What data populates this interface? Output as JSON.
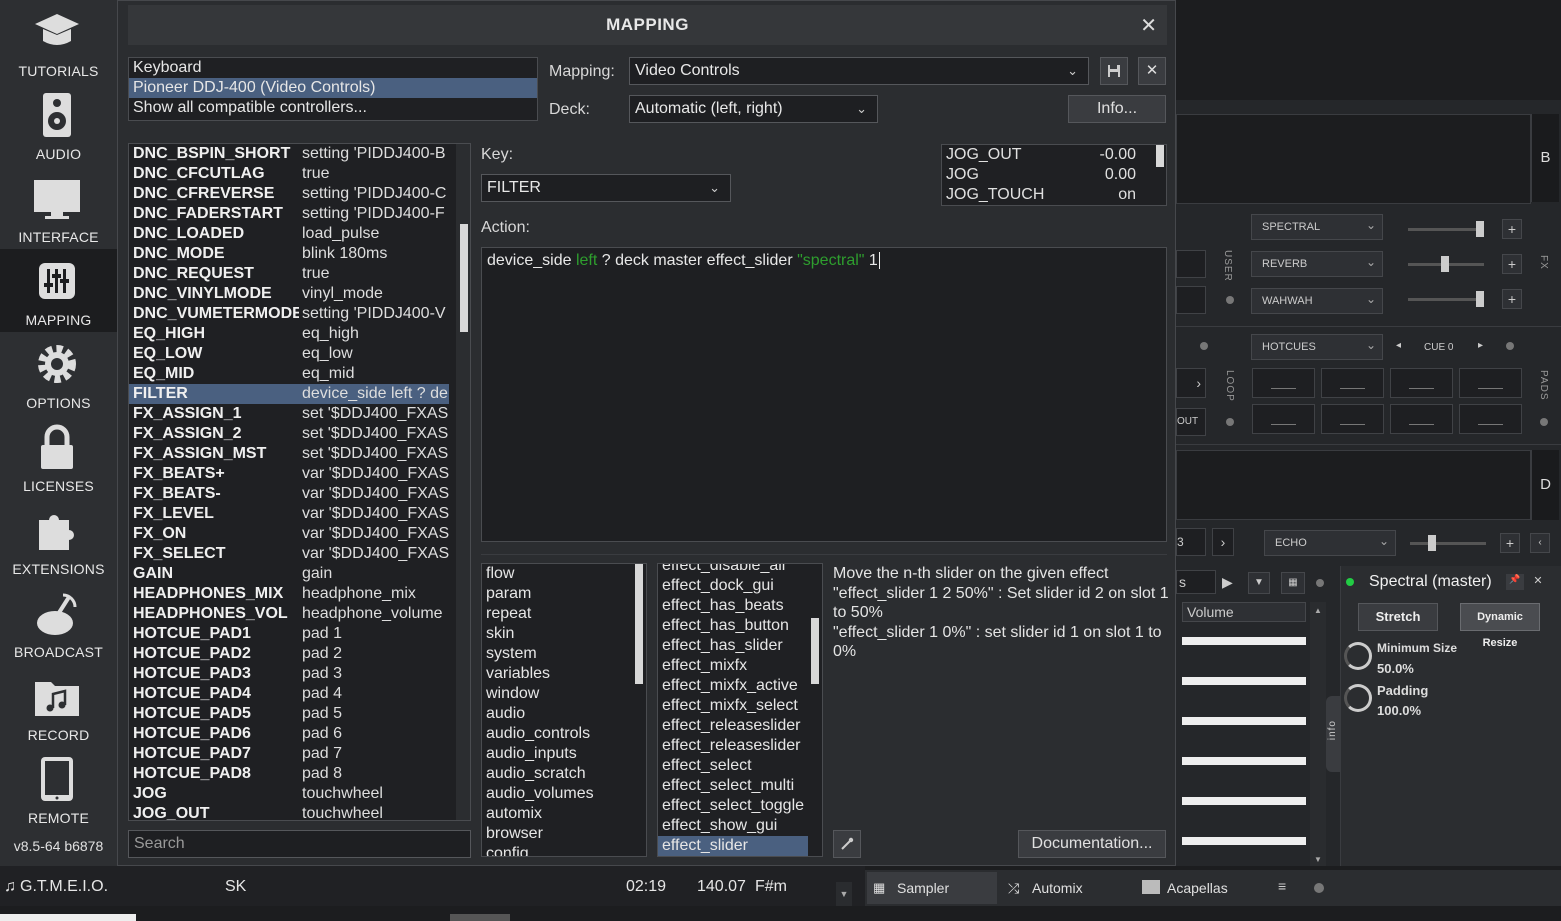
{
  "sidebar": {
    "items": [
      {
        "label": "TUTORIALS",
        "icon": "graduation-cap-icon"
      },
      {
        "label": "AUDIO",
        "icon": "speaker-icon"
      },
      {
        "label": "INTERFACE",
        "icon": "monitor-icon"
      },
      {
        "label": "MAPPING",
        "icon": "sliders-icon"
      },
      {
        "label": "OPTIONS",
        "icon": "gear-icon"
      },
      {
        "label": "LICENSES",
        "icon": "lock-icon"
      },
      {
        "label": "EXTENSIONS",
        "icon": "puzzle-icon"
      },
      {
        "label": "BROADCAST",
        "icon": "satellite-icon"
      },
      {
        "label": "RECORD",
        "icon": "music-folder-icon"
      },
      {
        "label": "REMOTE",
        "icon": "tablet-icon"
      }
    ],
    "version": "v8.5-64 b6878"
  },
  "dialog": {
    "title": "MAPPING",
    "controllers": [
      "Keyboard",
      "Pioneer DDJ-400 (Video Controls)",
      "Show all compatible controllers..."
    ],
    "mapping_label": "Mapping:",
    "mapping_value": "Video Controls",
    "deck_label": "Deck:",
    "deck_value": "Automatic (left, right)",
    "info_button": "Info...",
    "key_label": "Key:",
    "key_value": "FILTER",
    "action_label": "Action:",
    "action_tokens": [
      "device_side ",
      "left",
      " ? deck master effect_slider ",
      "\"spectral\"",
      " 1"
    ],
    "monitor": [
      {
        "name": "JOG_OUT",
        "value": "-0.00"
      },
      {
        "name": "JOG",
        "value": "0.00"
      },
      {
        "name": "JOG_TOUCH",
        "value": "on"
      }
    ],
    "search_placeholder": "Search",
    "documentation_button": "Documentation...",
    "keys": [
      {
        "name": "DNC_BSPIN_SHORT",
        "value": "setting 'PIDDJ400-B"
      },
      {
        "name": "DNC_CFCUTLAG",
        "value": "true"
      },
      {
        "name": "DNC_CFREVERSE",
        "value": "setting 'PIDDJ400-C"
      },
      {
        "name": "DNC_FADERSTART",
        "value": "setting 'PIDDJ400-F"
      },
      {
        "name": "DNC_LOADED",
        "value": "load_pulse"
      },
      {
        "name": "DNC_MODE",
        "value": "blink 180ms"
      },
      {
        "name": "DNC_REQUEST",
        "value": "true"
      },
      {
        "name": "DNC_VINYLMODE",
        "value": "vinyl_mode"
      },
      {
        "name": "DNC_VUMETERMODE",
        "value": "setting 'PIDDJ400-V"
      },
      {
        "name": "EQ_HIGH",
        "value": "eq_high"
      },
      {
        "name": "EQ_LOW",
        "value": "eq_low"
      },
      {
        "name": "EQ_MID",
        "value": "eq_mid"
      },
      {
        "name": "FILTER",
        "value": "device_side left ? de"
      },
      {
        "name": "FX_ASSIGN_1",
        "value": "set '$DDJ400_FXAS"
      },
      {
        "name": "FX_ASSIGN_2",
        "value": "set '$DDJ400_FXAS"
      },
      {
        "name": "FX_ASSIGN_MST",
        "value": "set '$DDJ400_FXAS"
      },
      {
        "name": "FX_BEATS+",
        "value": "var '$DDJ400_FXAS"
      },
      {
        "name": "FX_BEATS-",
        "value": "var '$DDJ400_FXAS"
      },
      {
        "name": "FX_LEVEL",
        "value": "var '$DDJ400_FXAS"
      },
      {
        "name": "FX_ON",
        "value": "var '$DDJ400_FXAS"
      },
      {
        "name": "FX_SELECT",
        "value": "var '$DDJ400_FXAS"
      },
      {
        "name": "GAIN",
        "value": "gain"
      },
      {
        "name": "HEADPHONES_MIX",
        "value": "headphone_mix"
      },
      {
        "name": "HEADPHONES_VOL",
        "value": "headphone_volume"
      },
      {
        "name": "HOTCUE_PAD1",
        "value": "pad 1"
      },
      {
        "name": "HOTCUE_PAD2",
        "value": "pad 2"
      },
      {
        "name": "HOTCUE_PAD3",
        "value": "pad 3"
      },
      {
        "name": "HOTCUE_PAD4",
        "value": "pad 4"
      },
      {
        "name": "HOTCUE_PAD5",
        "value": "pad 5"
      },
      {
        "name": "HOTCUE_PAD6",
        "value": "pad 6"
      },
      {
        "name": "HOTCUE_PAD7",
        "value": "pad 7"
      },
      {
        "name": "HOTCUE_PAD8",
        "value": "pad 8"
      },
      {
        "name": "JOG",
        "value": "touchwheel"
      },
      {
        "name": "JOG_OUT",
        "value": "touchwheel"
      }
    ],
    "categories": [
      "flow",
      "param",
      "repeat",
      "skin",
      "system",
      "variables",
      "window",
      "audio",
      "audio_controls",
      "audio_inputs",
      "audio_scratch",
      "audio_volumes",
      "automix",
      "browser",
      "config"
    ],
    "verbs": [
      "effect_disable_all",
      "effect_dock_gui",
      "effect_has_beats",
      "effect_has_button",
      "effect_has_slider",
      "effect_mixfx",
      "effect_mixfx_active",
      "effect_mixfx_select",
      "effect_releaseslider",
      "effect_releaseslider",
      "effect_select",
      "effect_select_multi",
      "effect_select_toggle",
      "effect_show_gui",
      "effect_slider"
    ],
    "doc_lines": [
      "Move the n-th slider on the given effect",
      "\"effect_slider 1 2 50%\" : Set slider id 2 on slot 1 to 50%",
      "\"effect_slider 1 0%\" : set slider id 1 on slot 1 to 0%"
    ]
  },
  "right_panel": {
    "deck_b": "B",
    "deck_d": "D",
    "fx_slots": [
      "SPECTRAL",
      "REVERB",
      "WAHWAH"
    ],
    "fx_vertical": "FX",
    "user_vertical": "USER",
    "hotcues": "HOTCUES",
    "cue_label": "CUE 0",
    "loop_vertical": "LOOP",
    "pads_vertical": "PADS",
    "out_label": "OUT",
    "echo": "ECHO",
    "volume_col": "Volume",
    "effect_title": "Spectral (master)",
    "stretch_btn": "Stretch",
    "dynamic_btn": "Dynamic Resize",
    "min_size_label": "Minimum Size",
    "min_size_value": "50.0%",
    "padding_label": "Padding",
    "padding_value": "100.0%",
    "info_tab": "info",
    "partial_b": "3",
    "partial_s": "s"
  },
  "bottom": {
    "track_title": "G.T.M.E.I.O.",
    "track_artist": "SK",
    "track_time": "02:19",
    "track_bpm": "140.07",
    "track_key": "F#m",
    "tabs": [
      "Sampler",
      "Automix",
      "Acapellas"
    ]
  },
  "colors": {
    "selection": "#4a6080",
    "green_token": "#2e9e2e",
    "active_led": "#22cc44"
  }
}
